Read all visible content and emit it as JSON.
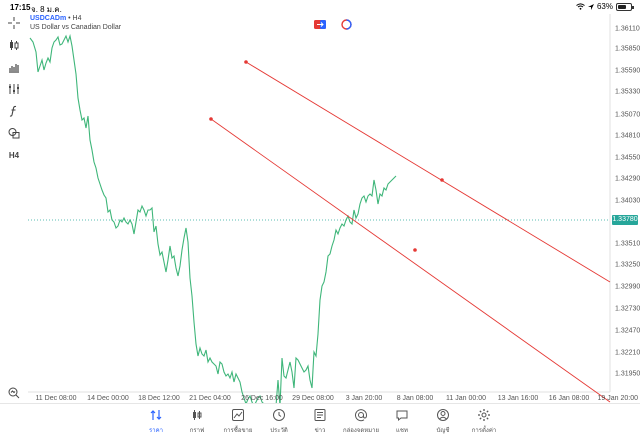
{
  "status": {
    "time": "17:15",
    "date": "จ. 8 ม.ค.",
    "battery": "63%",
    "battery_level": 0.63
  },
  "symbol": {
    "name": "USDCADm",
    "separator": "•",
    "timeframe": "H4",
    "description": "US Dollar vs Canadian Dollar"
  },
  "price_axis": [
    "1.36110",
    "1.35850",
    "1.35590",
    "1.35330",
    "1.35070",
    "1.34810",
    "1.34550",
    "1.34290",
    "1.34030",
    "1.33510",
    "1.33250",
    "1.32990",
    "1.32730",
    "1.32470",
    "1.32210",
    "1.31950"
  ],
  "current_price": "1.33780",
  "time_axis": [
    "11 Dec 08:00",
    "14 Dec 00:00",
    "18 Dec 12:00",
    "21 Dec 04:00",
    "26 Dec 16:00",
    "29 Dec 08:00",
    "3 Jan 20:00",
    "8 Jan 08:00",
    "11 Jan 00:00",
    "13 Jan 16:00",
    "16 Jan 08:00",
    "19 Jan 20:00"
  ],
  "toolbar": [
    "crosshair-icon",
    "candles-icon",
    "bars-icon",
    "indicators-icon",
    "function-icon",
    "shapes-icon",
    "timeframe-h4"
  ],
  "toolbar_h4_label": "H4",
  "nav": [
    {
      "label": "ราคา",
      "icon": "quotes-icon",
      "active": true
    },
    {
      "label": "กราฟ",
      "icon": "chart-icon",
      "active": false
    },
    {
      "label": "การซื้อขาย",
      "icon": "trade-icon",
      "active": false
    },
    {
      "label": "ประวัติ",
      "icon": "history-icon",
      "active": false
    },
    {
      "label": "ข่าว",
      "icon": "news-icon",
      "active": false
    },
    {
      "label": "กล่องจดหมาย",
      "icon": "mail-icon",
      "active": false
    },
    {
      "label": "แชท",
      "icon": "chat-icon",
      "active": false
    },
    {
      "label": "บัญชี",
      "icon": "account-icon",
      "active": false
    },
    {
      "label": "การตั้งค่า",
      "icon": "settings-icon",
      "active": false
    }
  ],
  "colors": {
    "line": "#3fb67a",
    "channel": "#e53935",
    "accent": "#2962ff",
    "price_tag": "#26a69a"
  }
}
